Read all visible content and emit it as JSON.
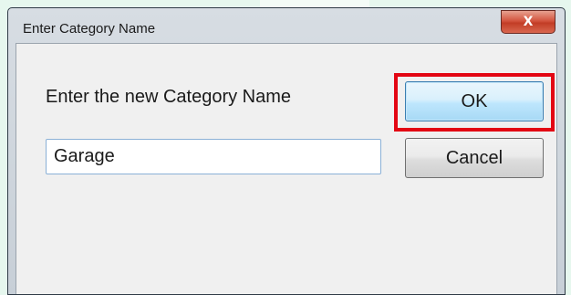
{
  "window": {
    "title": "Enter Category Name",
    "close_glyph": "X"
  },
  "dialog": {
    "prompt": "Enter the new Category Name",
    "input_value": "Garage",
    "ok_label": "OK",
    "cancel_label": "Cancel"
  },
  "colors": {
    "highlight": "#e30613",
    "ok_border": "#3c7fb1",
    "close_button": "#c94a33"
  }
}
